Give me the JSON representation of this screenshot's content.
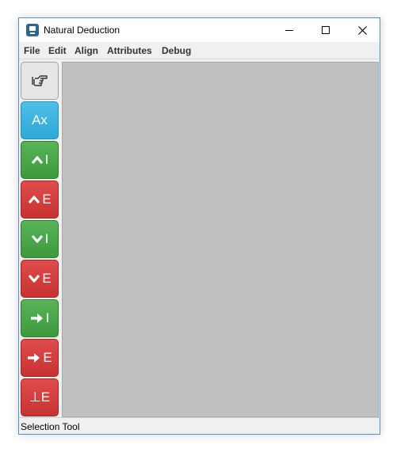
{
  "window": {
    "title": "Natural Deduction",
    "icon": "app-icon"
  },
  "menu": [
    "File",
    "Edit",
    "Align",
    "Attributes",
    "Debug"
  ],
  "tools": [
    {
      "id": "selection",
      "icon": "pointing-hand-icon",
      "label": "",
      "color": "#e6e6e6"
    },
    {
      "id": "axiom",
      "icon": "",
      "label": "Ax",
      "color": "#2ea8d6"
    },
    {
      "id": "and-intro",
      "icon": "and-icon",
      "label": "I",
      "color": "#3c9a3c"
    },
    {
      "id": "and-elim",
      "icon": "and-icon",
      "label": "E",
      "color": "#c73232"
    },
    {
      "id": "or-intro",
      "icon": "or-icon",
      "label": "I",
      "color": "#3c9a3c"
    },
    {
      "id": "or-elim",
      "icon": "or-icon",
      "label": "E",
      "color": "#c73232"
    },
    {
      "id": "implies-intro",
      "icon": "arrow-right-icon",
      "label": "I",
      "color": "#3c9a3c"
    },
    {
      "id": "implies-elim",
      "icon": "arrow-right-icon",
      "label": "E",
      "color": "#c73232"
    },
    {
      "id": "bottom-elim",
      "icon": "",
      "label": "⊥E",
      "color": "#c73232"
    }
  ],
  "status": "Selection Tool",
  "colors": {
    "canvas": "#c0c0c0",
    "chrome": "#f0f0f0",
    "window_border": "#5a8ec6"
  }
}
